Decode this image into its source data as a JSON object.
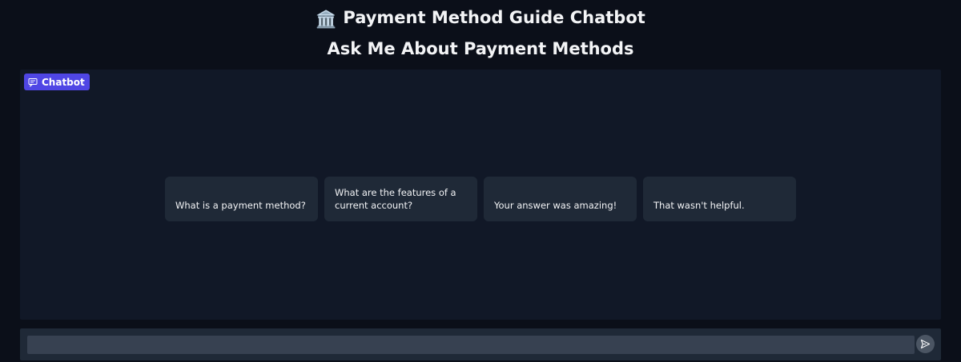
{
  "header": {
    "icon": "bank-icon",
    "icon_glyph": "🏛️",
    "title": "Payment Method Guide Chatbot",
    "subtitle": "Ask Me About Payment Methods"
  },
  "chatbot": {
    "label": "Chatbot",
    "label_icon": "chat-bubble-icon",
    "examples": [
      "What is a payment method?",
      "What are the features of a current account?",
      "Your answer was amazing!",
      "That wasn't helpful."
    ]
  },
  "input": {
    "value": "",
    "placeholder": "",
    "send_icon": "send-icon"
  },
  "colors": {
    "background": "#0b0f19",
    "panel": "#111827",
    "card": "#1f2937",
    "accent": "#4f46e5"
  }
}
